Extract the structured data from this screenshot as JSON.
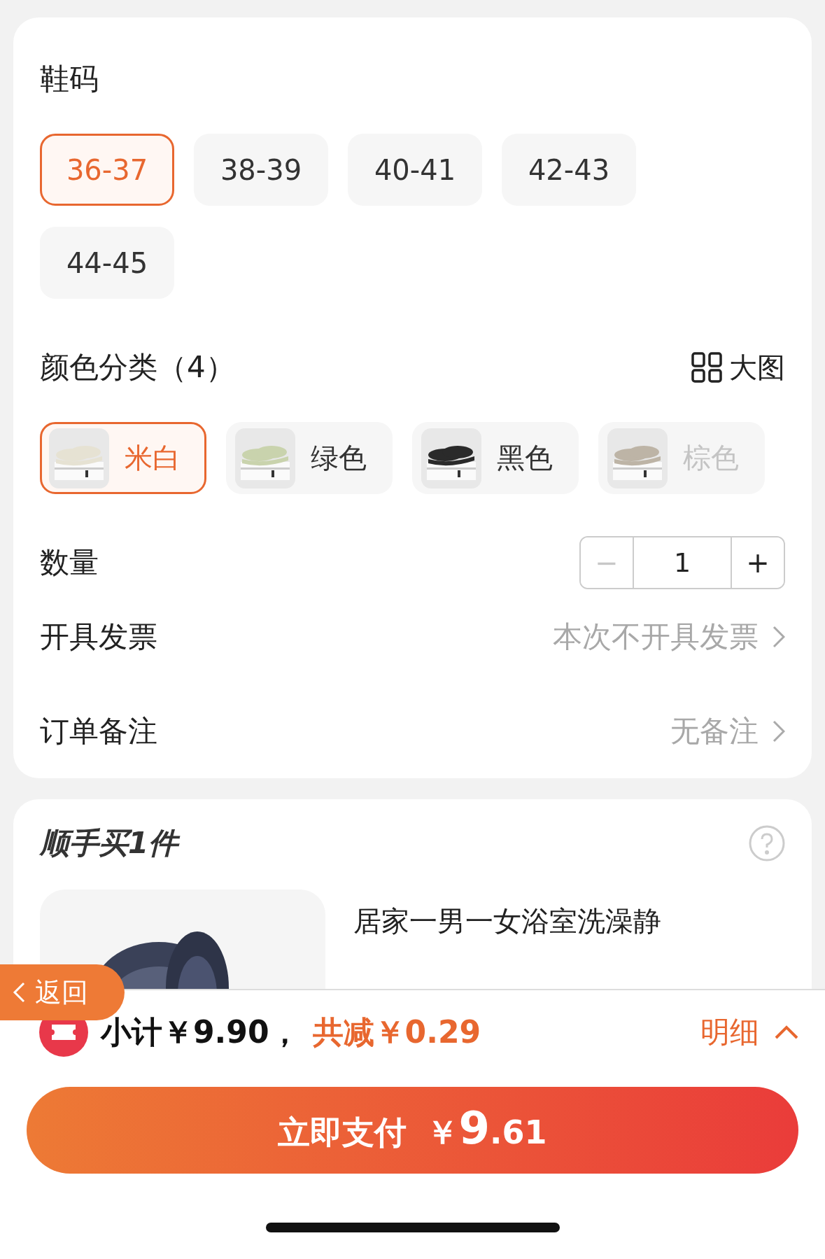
{
  "size_section": {
    "title": "鞋码",
    "options": [
      {
        "label": "36-37",
        "selected": true
      },
      {
        "label": "38-39",
        "selected": false
      },
      {
        "label": "40-41",
        "selected": false
      },
      {
        "label": "42-43",
        "selected": false
      },
      {
        "label": "44-45",
        "selected": false
      }
    ]
  },
  "color_section": {
    "title": "颜色分类（4）",
    "big_image_label": "大图",
    "options": [
      {
        "label": "米白",
        "selected": true,
        "disabled": false
      },
      {
        "label": "绿色",
        "selected": false,
        "disabled": false
      },
      {
        "label": "黑色",
        "selected": false,
        "disabled": false
      },
      {
        "label": "棕色",
        "selected": false,
        "disabled": true
      }
    ]
  },
  "quantity": {
    "label": "数量",
    "minus": "−",
    "value": "1",
    "plus": "+",
    "minus_disabled": true
  },
  "rows": [
    {
      "label": "开具发票",
      "value": "本次不开具发票"
    },
    {
      "label": "订单备注",
      "value": "无备注"
    }
  ],
  "addon": {
    "title": "顺手买1件",
    "product_title": "居家一男一女浴室洗澡静"
  },
  "back_button": {
    "label": "返回"
  },
  "summary": {
    "subtotal": "小计￥9.90，",
    "discount": "共减￥0.29",
    "details": "明细"
  },
  "pay_button": {
    "label": "立即支付",
    "currency": "￥",
    "amount_int": "9",
    "amount_dec": ".61"
  }
}
